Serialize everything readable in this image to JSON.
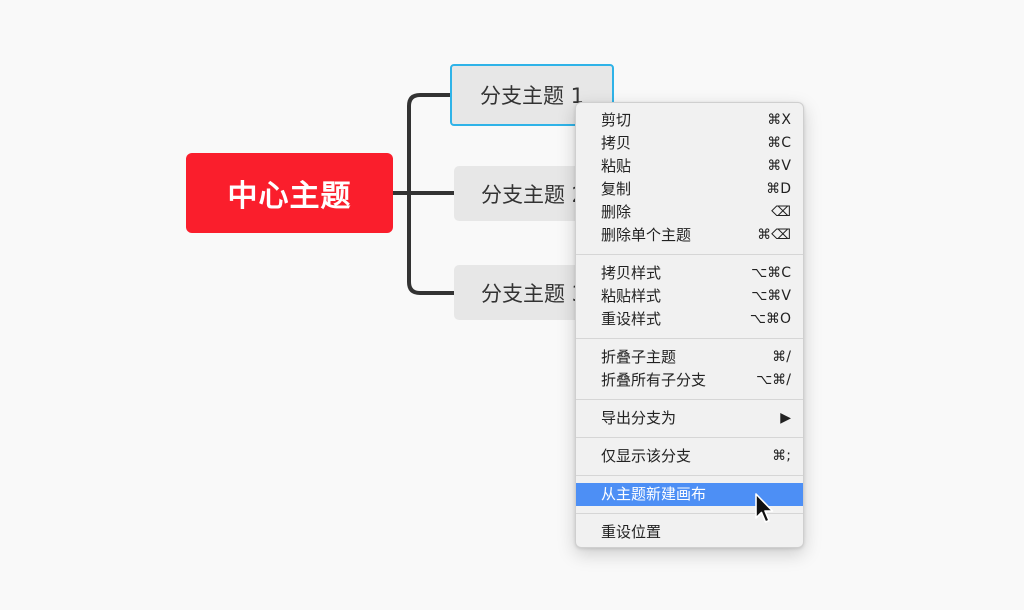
{
  "mindmap": {
    "central_topic": "中心主题",
    "branches": [
      {
        "label": "分支主题 1"
      },
      {
        "label": "分支主题 2"
      },
      {
        "label": "分支主题 3"
      }
    ]
  },
  "context_menu": {
    "groups": [
      [
        {
          "label": "剪切",
          "shortcut": "⌘X"
        },
        {
          "label": "拷贝",
          "shortcut": "⌘C"
        },
        {
          "label": "粘贴",
          "shortcut": "⌘V"
        },
        {
          "label": "复制",
          "shortcut": "⌘D"
        },
        {
          "label": "删除",
          "shortcut": "⌫"
        },
        {
          "label": "删除单个主题",
          "shortcut": "⌘⌫"
        }
      ],
      [
        {
          "label": "拷贝样式",
          "shortcut": "⌥⌘C"
        },
        {
          "label": "粘贴样式",
          "shortcut": "⌥⌘V"
        },
        {
          "label": "重设样式",
          "shortcut": "⌥⌘O"
        }
      ],
      [
        {
          "label": "折叠子主题",
          "shortcut": "⌘/"
        },
        {
          "label": "折叠所有子分支",
          "shortcut": "⌥⌘/"
        }
      ],
      [
        {
          "label": "导出分支为",
          "shortcut": "▶"
        }
      ],
      [
        {
          "label": "仅显示该分支",
          "shortcut": "⌘;"
        }
      ],
      [
        {
          "label": "从主题新建画布",
          "shortcut": ""
        }
      ],
      [
        {
          "label": "重设位置",
          "shortcut": ""
        }
      ]
    ],
    "highlighted_item": "从主题新建画布"
  },
  "colors": {
    "central_topic_bg": "#fa1e2c",
    "branch_bg": "#e7e7e7",
    "selection_border": "#2fb3e8",
    "menu_highlight": "#4d8ff5",
    "connector": "#333333"
  }
}
